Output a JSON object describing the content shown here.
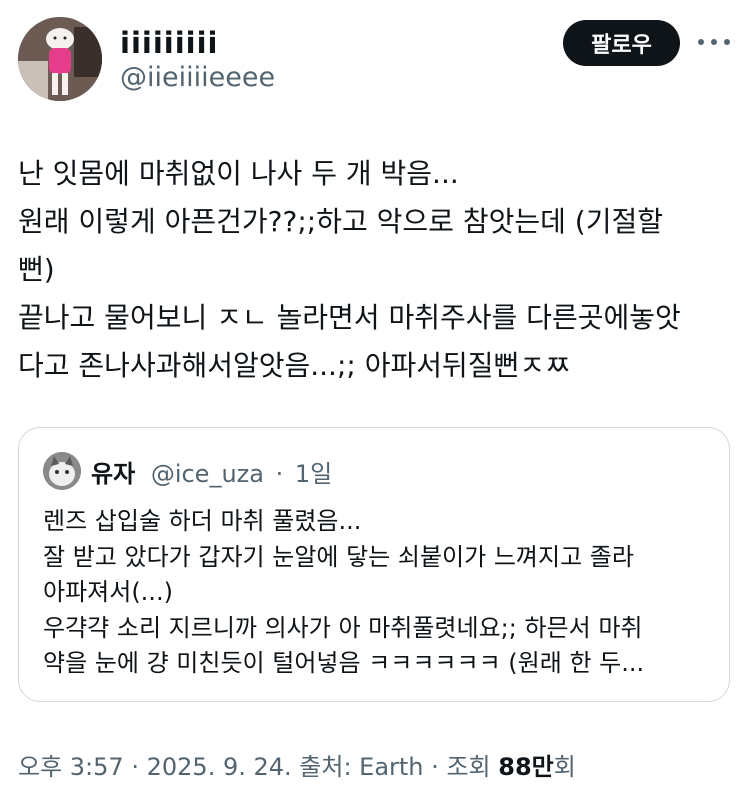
{
  "author": {
    "display_name": "iiiiiiiii",
    "handle": "@iieiiiieeee",
    "avatar_icon": "user-avatar"
  },
  "follow_label": "팔로우",
  "more_icon": "more-horizontal-icon",
  "tweet": {
    "lines": [
      "난 잇몸에 마취없이 나사 두 개 박음...",
      "원래 이렇게 아픈건가??;;하고 악으로 참앗는데 (기절할",
      "뻔)",
      "끝나고 물어보니 ㅈㄴ 놀라면서 마취주사를 다른곳에놓앗",
      "다고 존나사과해서알앗음...;; 아파서뒤질뻔ㅈㅉ"
    ]
  },
  "quote": {
    "display_name": "유자",
    "handle": "@ice_uza",
    "separator": "·",
    "time": "1일",
    "lines": [
      "렌즈 삽입술 하더 마취 풀렸음...",
      "잘 받고 았다가 갑자기 눈알에 닿는 쇠붙이가 느껴지고 졸라",
      "아파져서(...)",
      "우갹갹 소리 지르니까 의사가 아 마취풀렷네요;; 하믄서 마취",
      "약을 눈에 걍 미친듯이 털어넣음 ㅋㅋㅋㅋㅋㅋ (원래 한 두..."
    ]
  },
  "meta": {
    "time": "오후 3:57",
    "sep1": "·",
    "date": "2025. 9. 24.",
    "source": "출처: Earth",
    "sep2": "·",
    "views_label": "조회",
    "views_count": "88만",
    "views_suffix": "회"
  }
}
